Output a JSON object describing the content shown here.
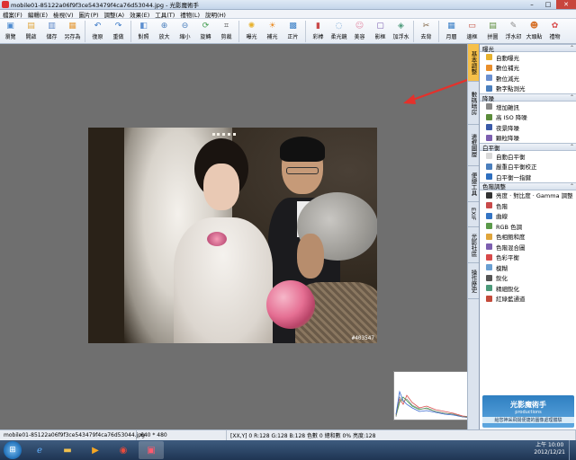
{
  "window": {
    "title": "mobile01-85122a06f9f3ce543479f4ca76d53044.jpg - 光影魔術手",
    "min": "–",
    "max": "□",
    "close": "✕"
  },
  "menu": [
    "檔案(F)",
    "編輯(E)",
    "檢視(V)",
    "圖片(P)",
    "調整(A)",
    "效果(E)",
    "工具(T)",
    "禮物(L)",
    "說明(H)"
  ],
  "toolbar": [
    {
      "label": "瀏覽",
      "icon": "browse-icon",
      "glyph": "▣",
      "color": "#4d8bd0"
    },
    {
      "label": "開啟",
      "icon": "open-icon",
      "glyph": "▤",
      "color": "#e0a53b"
    },
    {
      "label": "儲存",
      "icon": "save-icon",
      "glyph": "▥",
      "color": "#5a86c8"
    },
    {
      "label": "另存為",
      "icon": "save-as-icon",
      "glyph": "▦",
      "color": "#e49b3a"
    },
    {
      "label": "復原",
      "icon": "undo-icon",
      "glyph": "↶",
      "color": "#3474c4"
    },
    {
      "label": "重做",
      "icon": "redo-icon",
      "glyph": "↷",
      "color": "#3474c4"
    },
    {
      "label": "對照",
      "icon": "compare-icon",
      "glyph": "◧",
      "color": "#5d8fd0"
    },
    {
      "label": "放大",
      "icon": "zoom-in-icon",
      "glyph": "⊕",
      "color": "#4b7fbd"
    },
    {
      "label": "縮小",
      "icon": "zoom-out-icon",
      "glyph": "⊖",
      "color": "#4b7fbd"
    },
    {
      "label": "旋轉",
      "icon": "rotate-icon",
      "glyph": "⟳",
      "color": "#3d9a4a"
    },
    {
      "label": "剪裁",
      "icon": "crop-icon",
      "glyph": "⌗",
      "color": "#555555"
    },
    {
      "label": "曝光",
      "icon": "exposure-icon",
      "glyph": "✺",
      "color": "#e7b12c"
    },
    {
      "label": "補光",
      "icon": "fill-light-icon",
      "glyph": "☀",
      "color": "#e98e2a"
    },
    {
      "label": "正片",
      "icon": "positive-film-icon",
      "glyph": "▩",
      "color": "#3a7fc6"
    },
    {
      "label": "彩棒",
      "icon": "color-bar-icon",
      "glyph": "▮",
      "color": "#c94a4a"
    },
    {
      "label": "柔光鏡",
      "icon": "soft-light-icon",
      "glyph": "◌",
      "color": "#6a9fd2"
    },
    {
      "label": "美容",
      "icon": "beauty-icon",
      "glyph": "☺",
      "color": "#e28aa5"
    },
    {
      "label": "影框",
      "icon": "frame-icon",
      "glyph": "▢",
      "color": "#7d5fb0"
    },
    {
      "label": "加浮水",
      "icon": "watermark-icon",
      "glyph": "◈",
      "color": "#4c9a7a"
    },
    {
      "label": "去背",
      "icon": "cutout-icon",
      "glyph": "✂",
      "color": "#7a5c3a"
    },
    {
      "label": "月曆",
      "icon": "calendar-icon",
      "glyph": "▦",
      "color": "#3a7fc6"
    },
    {
      "label": "邊框",
      "icon": "border-icon",
      "glyph": "▭",
      "color": "#c44a3a"
    },
    {
      "label": "拼圖",
      "icon": "puzzle-icon",
      "glyph": "▤",
      "color": "#5b8c3a"
    },
    {
      "label": "浮水印",
      "icon": "stamp-icon",
      "glyph": "✎",
      "color": "#888888"
    },
    {
      "label": "大頭貼",
      "icon": "sticker-icon",
      "glyph": "☻",
      "color": "#d6732c"
    },
    {
      "label": "禮物",
      "icon": "gift-icon",
      "glyph": "✿",
      "color": "#d84a4a"
    }
  ],
  "side_tabs": [
    "基本調整",
    "數碼暗房",
    "邊框圖層",
    "便捷工具",
    "EXIF",
    "光影社區",
    "操作歷史"
  ],
  "panel": {
    "sections": [
      {
        "title": "曝光",
        "items": [
          {
            "label": "自動曝光",
            "color": "#e7b12c"
          },
          {
            "label": "數位補光",
            "color": "#e98e2a"
          },
          {
            "label": "數位減光",
            "color": "#6a8fd0"
          },
          {
            "label": "數字點測光",
            "color": "#4b7fbd"
          }
        ]
      },
      {
        "title": "降噪",
        "items": [
          {
            "label": "增加雜訊",
            "color": "#888888"
          },
          {
            "label": "高 ISO 降噪",
            "color": "#5b8c3a"
          },
          {
            "label": "夜景降噪",
            "color": "#3a5aa8"
          },
          {
            "label": "顆粒降噪",
            "color": "#7d5fb0"
          }
        ]
      },
      {
        "title": "白平衡",
        "items": [
          {
            "label": "自動白平衡",
            "color": "#d8d8d8"
          },
          {
            "label": "嚴重白平衡校正",
            "color": "#4b7fbd"
          },
          {
            "label": "白平衡一指鍵",
            "color": "#2f6fbf"
          }
        ]
      },
      {
        "title": "色階調整",
        "items": [
          {
            "label": "亮度 · 對比度 · Gamma 調整",
            "color": "#333333"
          },
          {
            "label": "色階",
            "color": "#c94a4a"
          },
          {
            "label": "曲線",
            "color": "#3474c4"
          },
          {
            "label": "RGB 色調",
            "color": "#5b9a4a"
          },
          {
            "label": "色相飽和度",
            "color": "#e0a53b"
          },
          {
            "label": "色階混合圖",
            "color": "#7d5fb0"
          },
          {
            "label": "色彩平衡",
            "color": "#d84a4a"
          },
          {
            "label": "模糊",
            "color": "#6a9fd2"
          },
          {
            "label": "銳化",
            "color": "#555555"
          },
          {
            "label": "精細銳化",
            "color": "#4c9a7a"
          },
          {
            "label": "紅綠藍通道",
            "color": "#c44a3a"
          }
        ]
      }
    ]
  },
  "ad": {
    "title": "光影魔術手",
    "subtitle": "productions",
    "note": "給您神采飛揚便捷的圖像處理體驗"
  },
  "status": {
    "file": "mobile01-85122a06f9f3ce543479f4ca76d53044.jpg",
    "size": "640 * 480",
    "pixel": "[XX,Y] 0 R:128 G:128 B:128 色數 0 總和數 0% 亮度:128"
  },
  "photo_watermark": "#403547",
  "clock": {
    "time": "上午 10:00",
    "date": "2012/12/21"
  },
  "histogram": {
    "label": "直方圖"
  }
}
